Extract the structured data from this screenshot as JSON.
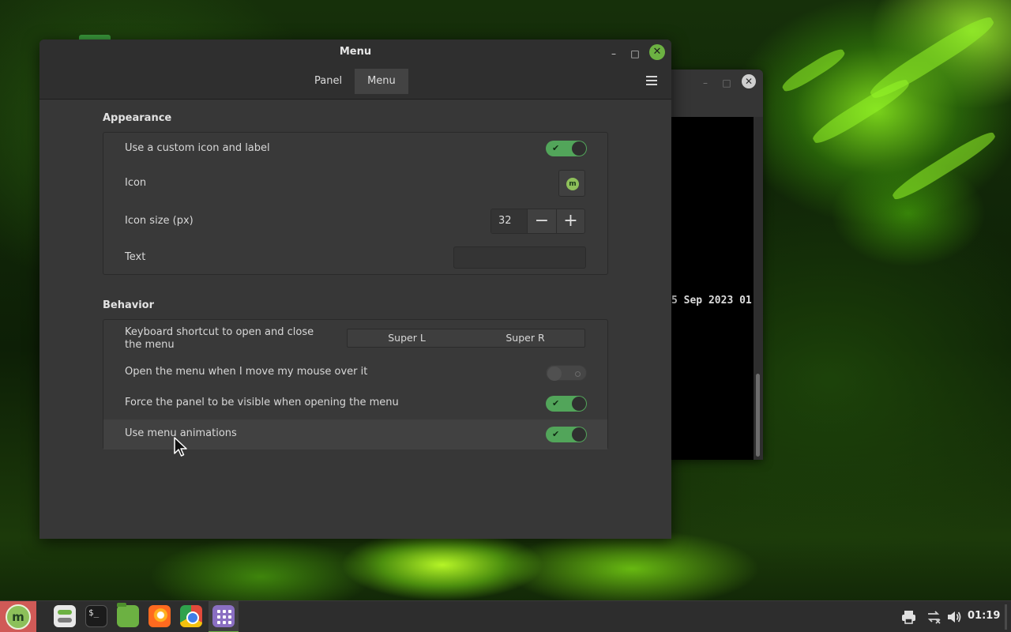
{
  "window": {
    "title": "Menu",
    "minimize_icon": "minimize-icon",
    "maximize_icon": "maximize-icon",
    "close_icon": "close-icon"
  },
  "tabs": [
    {
      "label": "Panel",
      "active": false
    },
    {
      "label": "Menu",
      "active": true
    }
  ],
  "appearance": {
    "title": "Appearance",
    "custom_icon_label": "Use a custom icon and label",
    "custom_icon_enabled": true,
    "icon_label": "Icon",
    "icon_size_label": "Icon size (px)",
    "icon_size_value": "32",
    "minus": "−",
    "plus": "+",
    "text_label": "Text",
    "text_value": ""
  },
  "behavior": {
    "title": "Behavior",
    "shortcut_label": "Keyboard shortcut to open and close the menu",
    "shortcut_values": [
      "Super L",
      "Super R"
    ],
    "hover_label": "Open the menu when I move my mouse over it",
    "hover_enabled": false,
    "force_panel_label": "Force the panel to be visible when opening the menu",
    "force_panel_enabled": true,
    "animations_label": "Use menu animations",
    "animations_enabled": true
  },
  "terminal": {
    "text": "5 Sep 2023 01"
  },
  "taskbar": {
    "launchers": [
      "system-settings-icon",
      "terminal-icon",
      "files-icon",
      "firefox-icon",
      "chrome-icon",
      "app-grid-icon"
    ],
    "tray": [
      "printer-icon",
      "network-icon",
      "volume-icon"
    ],
    "clock": "01:19"
  },
  "colors": {
    "accent": "#6cb142",
    "switch_on": "#52a55a",
    "menu_button": "#d05a57"
  }
}
